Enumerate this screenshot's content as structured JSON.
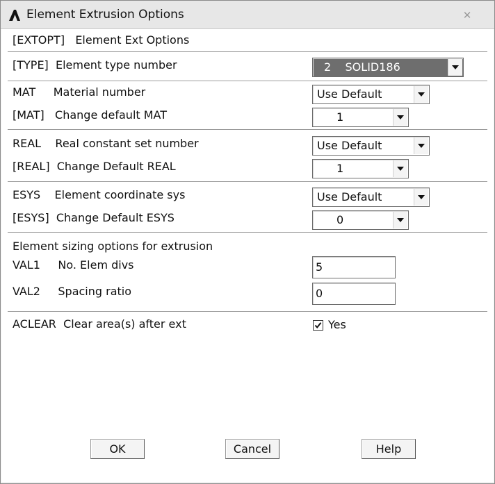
{
  "window": {
    "title": "Element Extrusion Options",
    "close_glyph": "✕"
  },
  "extopt": {
    "label": "[EXTOPT]   Element Ext Options"
  },
  "type": {
    "label": "[TYPE]  Element type number",
    "value": "2    SOLID186"
  },
  "mat": {
    "label": "MAT     Material number",
    "select": "Use Default",
    "change_label": "[MAT]   Change default MAT",
    "change_value": "1"
  },
  "real": {
    "label": "REAL    Real constant set number",
    "select": "Use Default",
    "change_label": "[REAL]  Change Default REAL",
    "change_value": "1"
  },
  "esys": {
    "label": "ESYS    Element coordinate sys",
    "select": "Use Default",
    "change_label": "[ESYS]  Change Default ESYS",
    "change_value": "0"
  },
  "sizing": {
    "heading": "Element sizing options for extrusion",
    "val1_label": "VAL1     No. Elem divs",
    "val1_value": "5",
    "val2_label": "VAL2     Spacing ratio",
    "val2_value": "0"
  },
  "aclear": {
    "label": "ACLEAR  Clear area(s) after ext",
    "checked": true,
    "option": "Yes"
  },
  "buttons": {
    "ok": "OK",
    "cancel": "Cancel",
    "help": "Help"
  },
  "icons": {
    "app": "ansys-logo-icon",
    "close": "close-icon",
    "dropdown": "chevron-down-icon",
    "check": "checkmark-icon"
  }
}
